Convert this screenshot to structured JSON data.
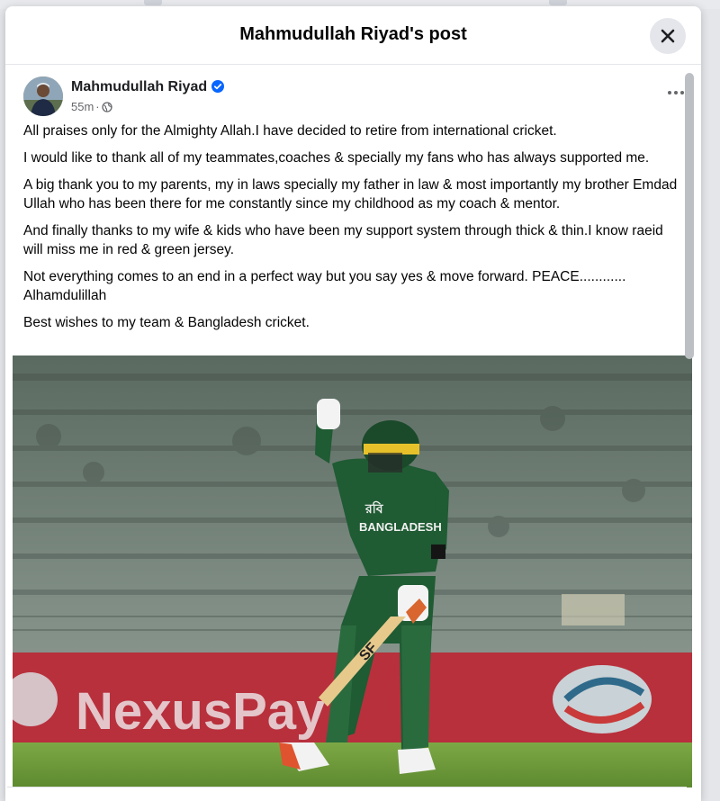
{
  "dialog": {
    "title": "Mahmudullah Riyad's post",
    "close_icon": "close-icon"
  },
  "post": {
    "author": "Mahmudullah Riyad",
    "verified": true,
    "timestamp": "55m",
    "separator": "·",
    "audience_icon": "globe-icon",
    "more_icon": "more-horizontal-icon",
    "paragraphs": [
      "All praises only for the Almighty Allah.I have decided to retire from international cricket.",
      "I would like to thank all of my teammates,coaches & specially my fans who has always supported me.",
      "A big thank you to my parents, my in laws specially my father in law & most importantly my brother Emdad Ullah who has been there  for me constantly since my childhood as my coach & mentor.",
      "And finally thanks to my wife & kids who have been my support system through thick & thin.I know raeid will miss me in red & green jersey.",
      "Not everything comes to an end in a perfect way but you say yes & move forward. PEACE............ Alhamdulillah",
      "Best wishes to my team & Bangladesh cricket."
    ],
    "photo": {
      "jersey_text_top": "রবি",
      "jersey_text": "BANGLADESH",
      "bat_text": "SF",
      "banner_text": "NexusPay"
    }
  },
  "colors": {
    "verified_blue": "#0866ff",
    "jersey_green": "#1f5b33",
    "banner_red": "#b8303c",
    "pitch_green": "#6f9a3c"
  }
}
